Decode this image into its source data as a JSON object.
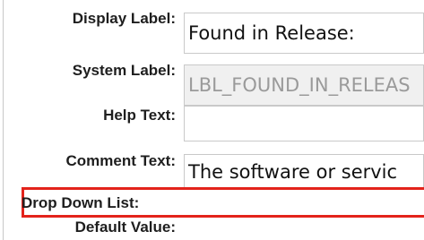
{
  "form": {
    "display_label": {
      "label": "Display Label:",
      "value": "Found in Release:"
    },
    "system_label": {
      "label": "System Label:",
      "value": "LBL_FOUND_IN_RELEAS"
    },
    "help_text": {
      "label": "Help Text:",
      "value": ""
    },
    "comment_text": {
      "label": "Comment Text:",
      "value": "The software or servic"
    },
    "drop_down_list": {
      "label": "Drop Down List:"
    },
    "default_value": {
      "label": "Default Value:"
    }
  },
  "colors": {
    "highlight": "#e3231b",
    "field_border": "#c9c9c9",
    "readonly_bg": "#f0f0f0"
  }
}
